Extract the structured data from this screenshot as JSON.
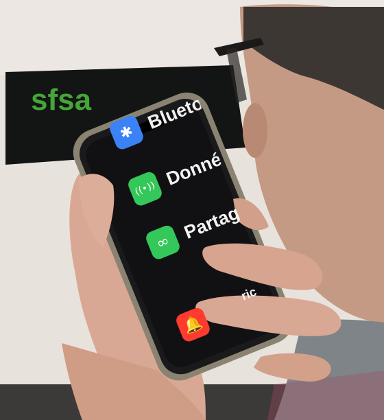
{
  "sign": {
    "text": "sfsa",
    "color": "#4fbf3f"
  },
  "settings_rows": [
    {
      "label": "Blueto",
      "icon": "bluetooth-icon",
      "icon_glyph": "✱",
      "color": "#3b82f6"
    },
    {
      "label": "Donné",
      "icon": "cellular-data-icon",
      "icon_glyph": "((•))",
      "color": "#34c759"
    },
    {
      "label": "Partag",
      "icon": "personal-hotspot-icon",
      "icon_glyph": "∞",
      "color": "#34c759"
    }
  ],
  "lower_rows": [
    {
      "label": "",
      "icon": "notifications-bell-icon",
      "icon_glyph": "🔔",
      "color": "#ff3b30"
    }
  ],
  "partial_text": "ric"
}
